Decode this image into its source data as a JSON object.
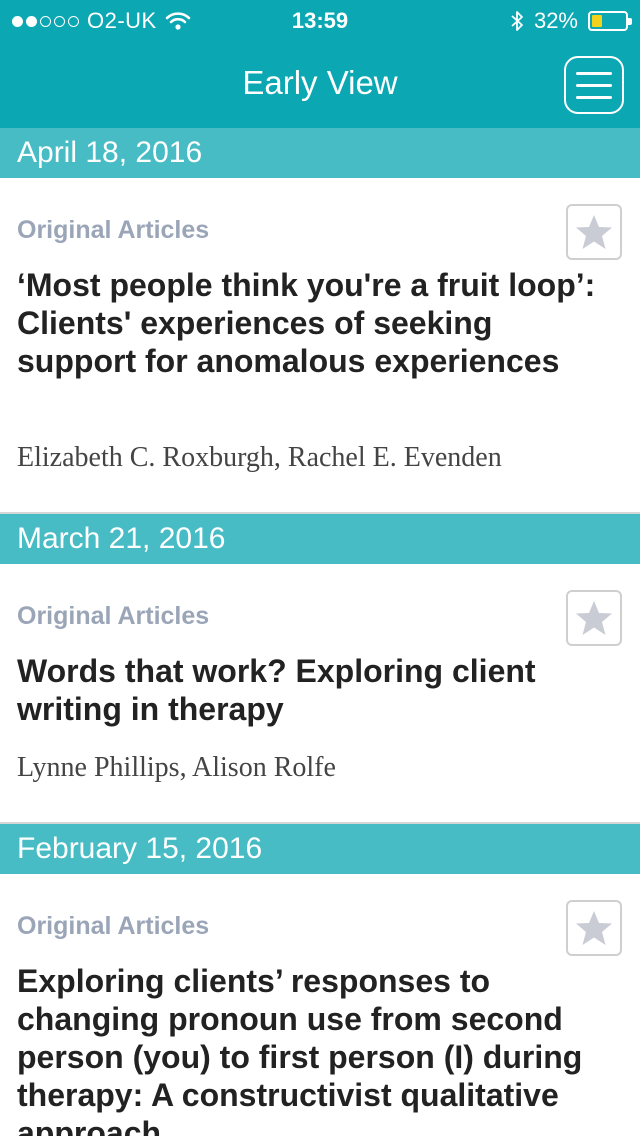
{
  "status_bar": {
    "carrier": "O2-UK",
    "time": "13:59",
    "battery": "32%",
    "battery_level": 0.32
  },
  "nav": {
    "title": "Early View",
    "menu_icon": "hamburger-menu-icon"
  },
  "sections": [
    {
      "date": "April 18, 2016",
      "article": {
        "category": "Original Articles",
        "title": "‘Most people think you're a fruit loop’: Clients' experiences of seeking support for anomalous experiences",
        "authors": "Elizabeth C. Roxburgh, Rachel E. Evenden"
      }
    },
    {
      "date": "March 21, 2016",
      "article": {
        "category": "Original Articles",
        "title": "Words that work? Exploring client writing in therapy",
        "authors": "Lynne Phillips, Alison Rolfe"
      }
    },
    {
      "date": "February 15, 2016",
      "article": {
        "category": "Original Articles",
        "title": "Exploring clients’ responses to changing pronoun use from second person (you) to first person (I) during therapy: A constructivist qualitative approach"
      }
    }
  ],
  "colors": {
    "nav_background": "#0ba7b3",
    "date_header": "#47bcc5",
    "category_text": "#9aa5b8",
    "star_fill": "#c9ccd4"
  }
}
